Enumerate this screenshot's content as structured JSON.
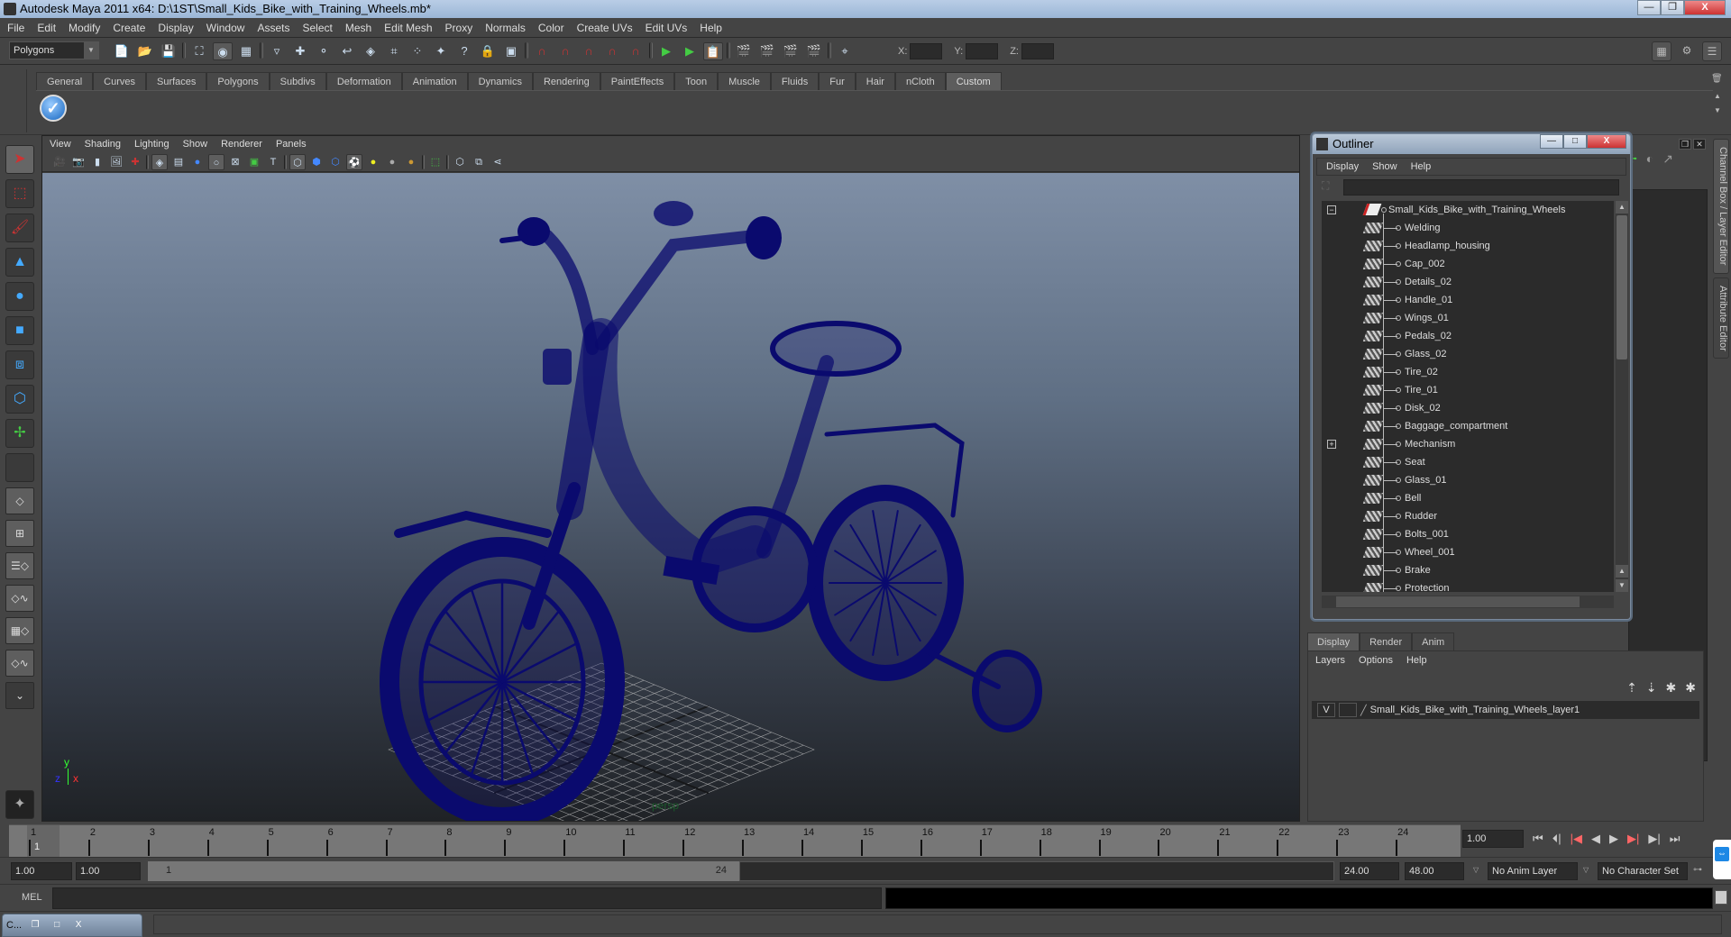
{
  "window": {
    "title": "Autodesk Maya 2011 x64: D:\\1ST\\Small_Kids_Bike_with_Training_Wheels.mb*",
    "min_label": "—",
    "restore_label": "❐",
    "close_label": "X"
  },
  "menubar": [
    "File",
    "Edit",
    "Modify",
    "Create",
    "Display",
    "Window",
    "Assets",
    "Select",
    "Mesh",
    "Edit Mesh",
    "Proxy",
    "Normals",
    "Color",
    "Create UVs",
    "Edit UVs",
    "Help"
  ],
  "toolbar": {
    "mode": "Polygons",
    "coords": {
      "x_label": "X:",
      "y_label": "Y:",
      "z_label": "Z:",
      "x": "",
      "y": "",
      "z": ""
    }
  },
  "shelf": {
    "tabs": [
      "General",
      "Curves",
      "Surfaces",
      "Polygons",
      "Subdivs",
      "Deformation",
      "Animation",
      "Dynamics",
      "Rendering",
      "PaintEffects",
      "Toon",
      "Muscle",
      "Fluids",
      "Fur",
      "Hair",
      "nCloth",
      "Custom"
    ],
    "active_tab": "Custom",
    "check_label": "✓"
  },
  "viewport": {
    "menu": [
      "View",
      "Shading",
      "Lighting",
      "Show",
      "Renderer",
      "Panels"
    ],
    "camera": "persp",
    "axis": {
      "y": "y",
      "z": "z",
      "x": "x"
    },
    "wire_color": "#0a0a6e"
  },
  "outliner": {
    "title": "Outliner",
    "menu": [
      "Display",
      "Show",
      "Help"
    ],
    "search_value": "",
    "root": "Small_Kids_Bike_with_Training_Wheels",
    "root_expanded": true,
    "items": [
      {
        "name": "Welding",
        "expandable": false
      },
      {
        "name": "Headlamp_housing",
        "expandable": false
      },
      {
        "name": "Cap_002",
        "expandable": false
      },
      {
        "name": "Details_02",
        "expandable": false
      },
      {
        "name": "Handle_01",
        "expandable": false
      },
      {
        "name": "Wings_01",
        "expandable": false
      },
      {
        "name": "Pedals_02",
        "expandable": false
      },
      {
        "name": "Glass_02",
        "expandable": false
      },
      {
        "name": "Tire_02",
        "expandable": false
      },
      {
        "name": "Tire_01",
        "expandable": false
      },
      {
        "name": "Disk_02",
        "expandable": false
      },
      {
        "name": "Baggage_compartment",
        "expandable": false
      },
      {
        "name": "Mechanism",
        "expandable": true
      },
      {
        "name": "Seat",
        "expandable": false
      },
      {
        "name": "Glass_01",
        "expandable": false
      },
      {
        "name": "Bell",
        "expandable": false
      },
      {
        "name": "Rudder",
        "expandable": false
      },
      {
        "name": "Bolts_001",
        "expandable": false
      },
      {
        "name": "Wheel_001",
        "expandable": false
      },
      {
        "name": "Brake",
        "expandable": false
      },
      {
        "name": "Protection",
        "expandable": false
      }
    ]
  },
  "side_tabs": {
    "channel_box": "Channel Box / Layer Editor",
    "attribute_editor": "Attribute Editor"
  },
  "layer_editor": {
    "tabs": [
      "Display",
      "Render",
      "Anim"
    ],
    "active_tab": "Display",
    "menu": [
      "Layers",
      "Options",
      "Help"
    ],
    "layers": [
      {
        "visible": "V",
        "playback": "",
        "name": "Small_Kids_Bike_with_Training_Wheels_layer1"
      }
    ]
  },
  "timeline": {
    "ticks": [
      "1",
      "2",
      "3",
      "4",
      "5",
      "6",
      "7",
      "8",
      "9",
      "10",
      "11",
      "12",
      "13",
      "14",
      "15",
      "16",
      "17",
      "18",
      "19",
      "20",
      "21",
      "22",
      "23",
      "24"
    ],
    "current_frame": "1",
    "current_time": "1.00"
  },
  "range": {
    "start_time": "1.00",
    "playback_start": "1.00",
    "slider_start": "1",
    "slider_end": "24",
    "playback_end": "24.00",
    "end_time": "48.00",
    "anim_layer": "No Anim Layer",
    "character_set": "No Character Set"
  },
  "mel": {
    "label": "MEL",
    "input": "",
    "output": ""
  },
  "minimized_window": {
    "label": "C..."
  }
}
